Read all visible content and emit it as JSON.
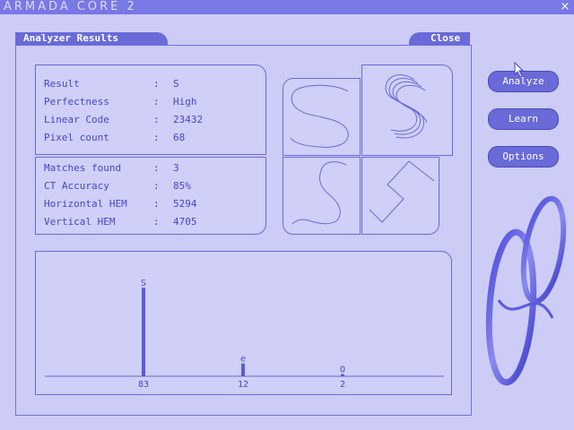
{
  "window": {
    "title": "ARMADA CORE 2",
    "close_glyph": "×"
  },
  "panel": {
    "tab_title": "Analyzer Results",
    "close_label": "Close"
  },
  "info_top": [
    {
      "label": "Result",
      "value": "S"
    },
    {
      "label": "Perfectness",
      "value": "High"
    },
    {
      "label": "Linear Code",
      "value": "23432"
    },
    {
      "label": "Pixel count",
      "value": "68"
    }
  ],
  "info_bottom": [
    {
      "label": "Matches found",
      "value": "3"
    },
    {
      "label": "CT Accuracy",
      "value": "85%"
    },
    {
      "label": "Horizontal HEM",
      "value": "5294"
    },
    {
      "label": "Vertical HEM",
      "value": "4705"
    }
  ],
  "separator": ":",
  "buttons": {
    "analyze": "Analyze",
    "learn": "Learn",
    "options": "Options"
  },
  "colors": {
    "accent": "#6a6ad8",
    "panel_bg": "#cfcff7",
    "text": "#4646c8",
    "titlebar": "#7878e6"
  },
  "chart_data": {
    "type": "bar",
    "categories": [
      "S",
      "e",
      "O"
    ],
    "values": [
      83,
      12,
      2
    ],
    "ylim": [
      0,
      100
    ]
  }
}
